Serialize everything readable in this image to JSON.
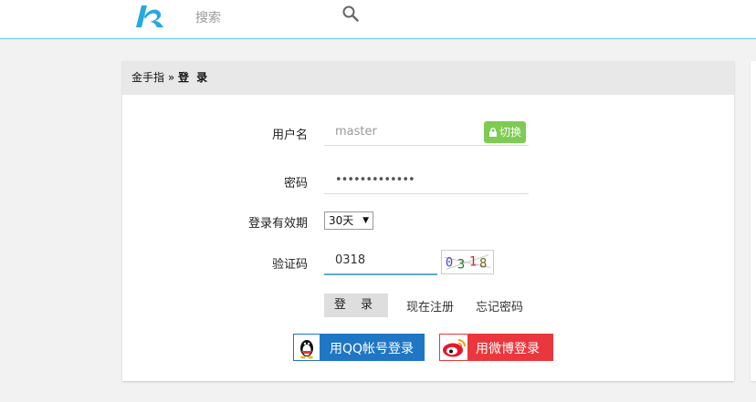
{
  "header": {
    "logo_icon": "k-logo-icon",
    "search_placeholder": "搜索",
    "search_icon": "search-icon"
  },
  "breadcrumb": {
    "home": "金手指",
    "separator": " » ",
    "current": "登 录"
  },
  "form": {
    "username_label": "用户名",
    "username_placeholder": "master",
    "switch_label": "切换",
    "password_label": "密码",
    "password_value": "•••••••••••••",
    "expiry_label": "登录有效期",
    "expiry_selected": "30天",
    "captcha_label": "验证码",
    "captcha_value": "0318",
    "captcha_chars": [
      "0",
      "3",
      "1",
      "8"
    ],
    "login_button": "登 录",
    "register_link": "现在注册",
    "forgot_link": "忘记密码",
    "qq_login": "用QQ帐号登录",
    "weibo_login": "用微博登录"
  },
  "colors": {
    "accent_line": "#5fc7dd",
    "switch_green": "#7dcb52",
    "qq_blue": "#1e76c5",
    "weibo_red": "#e9373d"
  }
}
